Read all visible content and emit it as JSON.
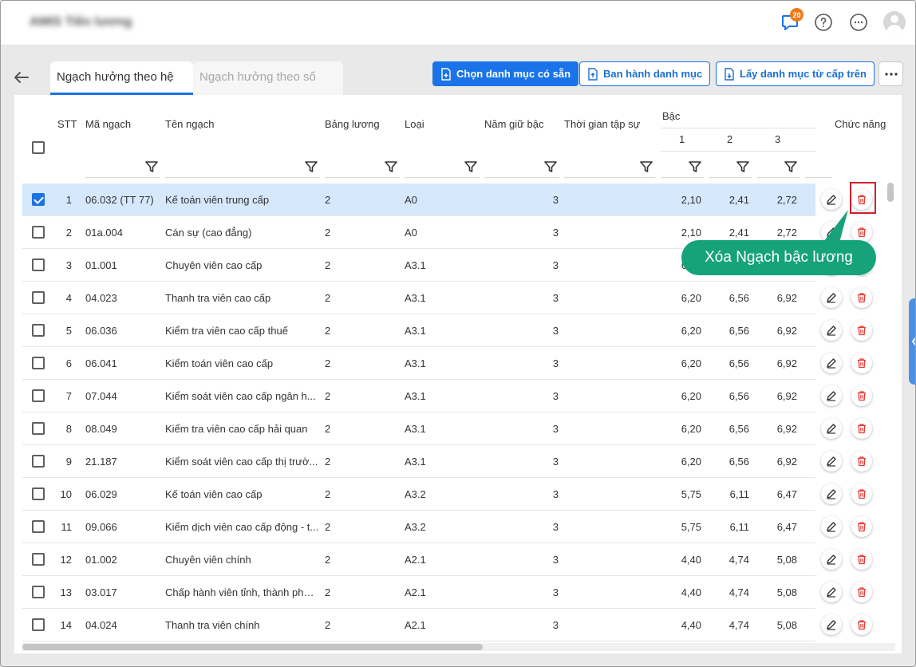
{
  "header": {
    "brand_text": "AMIS Tiền lương",
    "notification_count": "20"
  },
  "tabs": [
    {
      "label": "Ngạch hưởng theo hệ số",
      "active": true
    },
    {
      "label": "Ngạch hưởng theo số tiền",
      "active": false
    }
  ],
  "toolbar": {
    "choose_label": "Chọn danh mục có sẵn",
    "issue_label": "Ban hành danh mục",
    "fetch_label": "Lấy danh mục từ cấp trên"
  },
  "table": {
    "headers": {
      "stt": "STT",
      "ma_ngach": "Mã ngạch",
      "ten_ngach": "Tên ngạch",
      "bang_luong": "Bảng lương",
      "loai": "Loại",
      "nam_giu_bac": "Năm giữ bậc",
      "thoi_gian_tap_su": "Thời gian tập sự",
      "bac": "Bậc",
      "bac_1": "1",
      "bac_2": "2",
      "bac_3": "3",
      "chuc_nang": "Chức năng"
    },
    "rows": [
      {
        "stt": "1",
        "ma": "06.032 (TT 77)",
        "ten": "Kế toán viên trung cấp",
        "bang": "2",
        "loai": "A0",
        "nam": "3",
        "b1": "2,10",
        "b2": "2,41",
        "b3": "2,72",
        "checked": true
      },
      {
        "stt": "2",
        "ma": "01a.004",
        "ten": "Cán sự (cao đẳng)",
        "bang": "2",
        "loai": "A0",
        "nam": "3",
        "b1": "2,10",
        "b2": "2,41",
        "b3": "2,72",
        "checked": false
      },
      {
        "stt": "3",
        "ma": "01.001",
        "ten": "Chuyên viên cao cấp",
        "bang": "2",
        "loai": "A3.1",
        "nam": "3",
        "b1": "6,20",
        "b2": "6,56",
        "b3": "6,92",
        "checked": false
      },
      {
        "stt": "4",
        "ma": "04.023",
        "ten": "Thanh tra viên cao cấp",
        "bang": "2",
        "loai": "A3.1",
        "nam": "3",
        "b1": "6,20",
        "b2": "6,56",
        "b3": "6,92",
        "checked": false
      },
      {
        "stt": "5",
        "ma": "06.036",
        "ten": "Kiểm tra viên cao cấp thuế",
        "bang": "2",
        "loai": "A3.1",
        "nam": "3",
        "b1": "6,20",
        "b2": "6,56",
        "b3": "6,92",
        "checked": false
      },
      {
        "stt": "6",
        "ma": "06.041",
        "ten": "Kiểm toán viên cao cấp",
        "bang": "2",
        "loai": "A3.1",
        "nam": "3",
        "b1": "6,20",
        "b2": "6,56",
        "b3": "6,92",
        "checked": false
      },
      {
        "stt": "7",
        "ma": "07.044",
        "ten": "Kiểm soát viên cao cấp ngân h...",
        "bang": "2",
        "loai": "A3.1",
        "nam": "3",
        "b1": "6,20",
        "b2": "6,56",
        "b3": "6,92",
        "checked": false
      },
      {
        "stt": "8",
        "ma": "08.049",
        "ten": "Kiểm tra viên cao cấp hải quan",
        "bang": "2",
        "loai": "A3.1",
        "nam": "3",
        "b1": "6,20",
        "b2": "6,56",
        "b3": "6,92",
        "checked": false
      },
      {
        "stt": "9",
        "ma": "21.187",
        "ten": "Kiểm soát viên cao cấp thị trườ...",
        "bang": "2",
        "loai": "A3.1",
        "nam": "3",
        "b1": "6,20",
        "b2": "6,56",
        "b3": "6,92",
        "checked": false
      },
      {
        "stt": "10",
        "ma": "06.029",
        "ten": "Kế toán viên cao cấp",
        "bang": "2",
        "loai": "A3.2",
        "nam": "3",
        "b1": "5,75",
        "b2": "6,11",
        "b3": "6,47",
        "checked": false
      },
      {
        "stt": "11",
        "ma": "09.066",
        "ten": "Kiểm dịch viên cao cấp động - t...",
        "bang": "2",
        "loai": "A3.2",
        "nam": "3",
        "b1": "5,75",
        "b2": "6,11",
        "b3": "6,47",
        "checked": false
      },
      {
        "stt": "12",
        "ma": "01.002",
        "ten": "Chuyên viên chính",
        "bang": "2",
        "loai": "A2.1",
        "nam": "3",
        "b1": "4,40",
        "b2": "4,74",
        "b3": "5,08",
        "checked": false
      },
      {
        "stt": "13",
        "ma": "03.017",
        "ten": "Chấp hành viên tỉnh, thành phố ...",
        "bang": "2",
        "loai": "A2.1",
        "nam": "3",
        "b1": "4,40",
        "b2": "4,74",
        "b3": "5,08",
        "checked": false
      },
      {
        "stt": "14",
        "ma": "04.024",
        "ten": "Thanh tra viên chính",
        "bang": "2",
        "loai": "A2.1",
        "nam": "3",
        "b1": "4,40",
        "b2": "4,74",
        "b3": "5,08",
        "checked": false
      }
    ]
  },
  "tooltip": {
    "text": "Xóa Ngạch bậc lương"
  },
  "colors": {
    "primary": "#1a73e8",
    "selected_row": "#d6e8fb",
    "delete": "#e53935",
    "tooltip": "#16a27a",
    "highlight": "#d0202a"
  },
  "icons": [
    "back-arrow-icon",
    "chat-icon",
    "help-icon",
    "more-icon",
    "avatar-icon",
    "filter-icon",
    "edit-icon",
    "trash-icon",
    "chevron-left-icon"
  ]
}
